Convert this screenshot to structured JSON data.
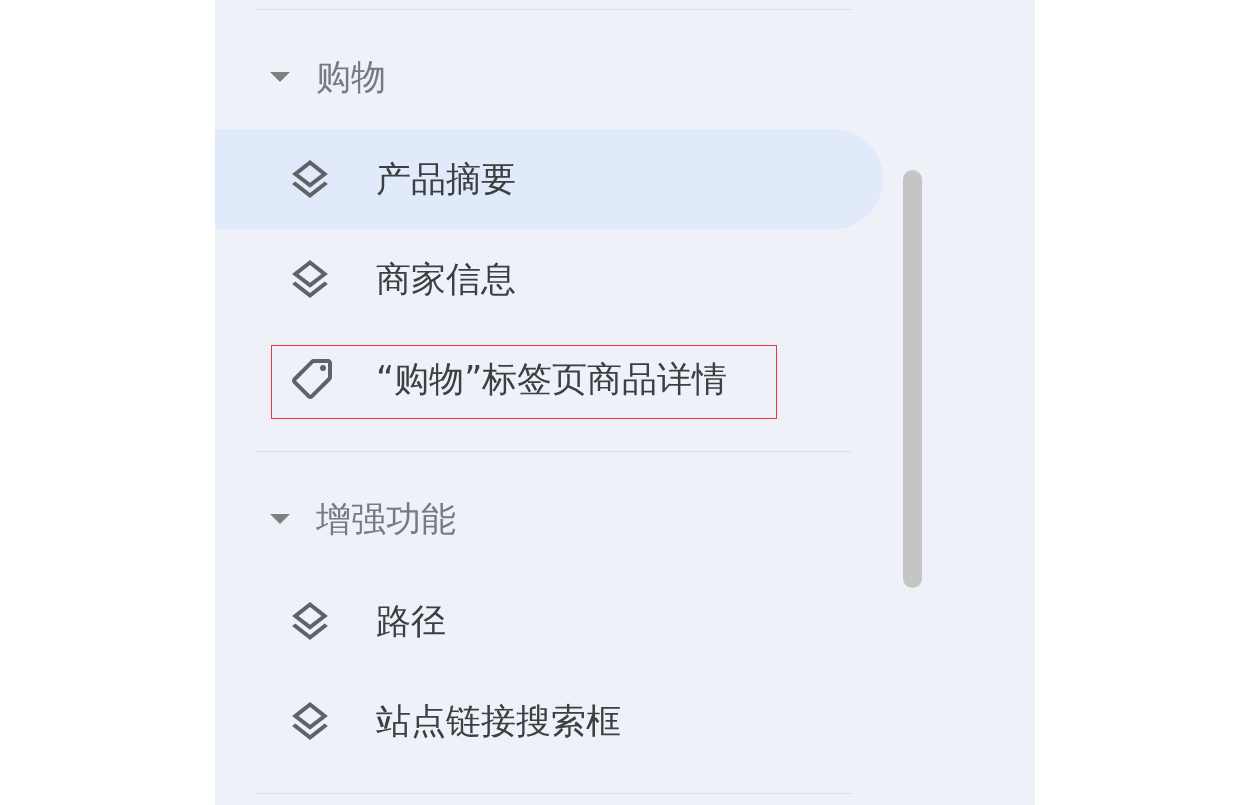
{
  "sections": [
    {
      "title": "购物",
      "expanded": true,
      "items": [
        {
          "kind": "layers",
          "label": "产品摘要",
          "selected": true,
          "highlighted": false
        },
        {
          "kind": "layers",
          "label": "商家信息",
          "selected": false,
          "highlighted": false
        },
        {
          "kind": "tag",
          "label": "“购物”标签页商品详情",
          "selected": false,
          "highlighted": true
        }
      ]
    },
    {
      "title": "增强功能",
      "expanded": true,
      "items": [
        {
          "kind": "layers",
          "label": "路径",
          "selected": false,
          "highlighted": false
        },
        {
          "kind": "layers",
          "label": "站点链接搜索框",
          "selected": false,
          "highlighted": false
        }
      ]
    }
  ]
}
